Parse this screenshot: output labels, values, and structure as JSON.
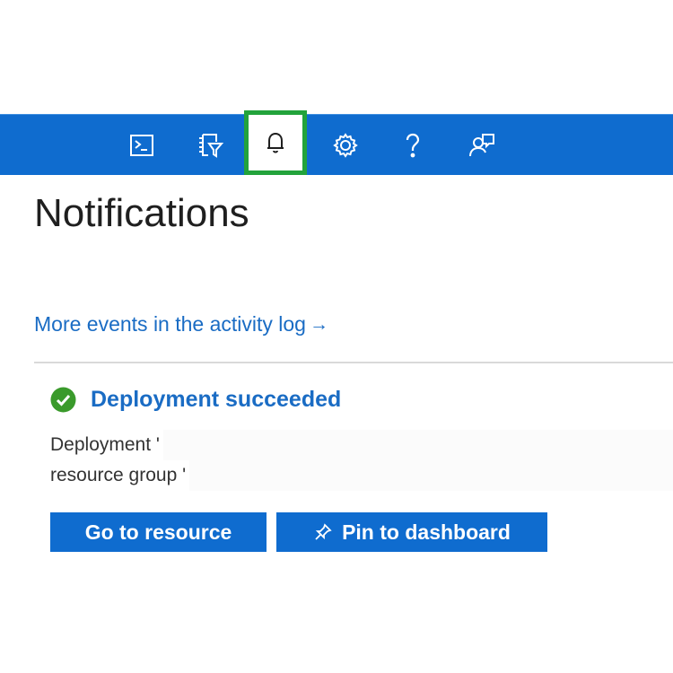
{
  "topbar": {
    "colors": {
      "bar": "#0f6ccf",
      "highlight": "#22a33b"
    },
    "icons": [
      {
        "name": "cloud-shell-icon",
        "active": false
      },
      {
        "name": "directory-filter-icon",
        "active": false
      },
      {
        "name": "bell-icon",
        "active": true
      },
      {
        "name": "gear-icon",
        "active": false
      },
      {
        "name": "help-icon",
        "active": false
      },
      {
        "name": "feedback-icon",
        "active": false
      }
    ]
  },
  "panel": {
    "title": "Notifications",
    "activity_link": "More events in the activity log",
    "activity_link_arrow": "→"
  },
  "notification": {
    "status_icon": "check-circle-icon",
    "status_color": "#3a9a2b",
    "title": "Deployment succeeded",
    "line1": "Deployment '",
    "line2": "resource group '"
  },
  "actions": {
    "go_to_resource": "Go to resource",
    "pin_to_dashboard": "Pin to dashboard",
    "pin_icon": "pin-icon"
  }
}
